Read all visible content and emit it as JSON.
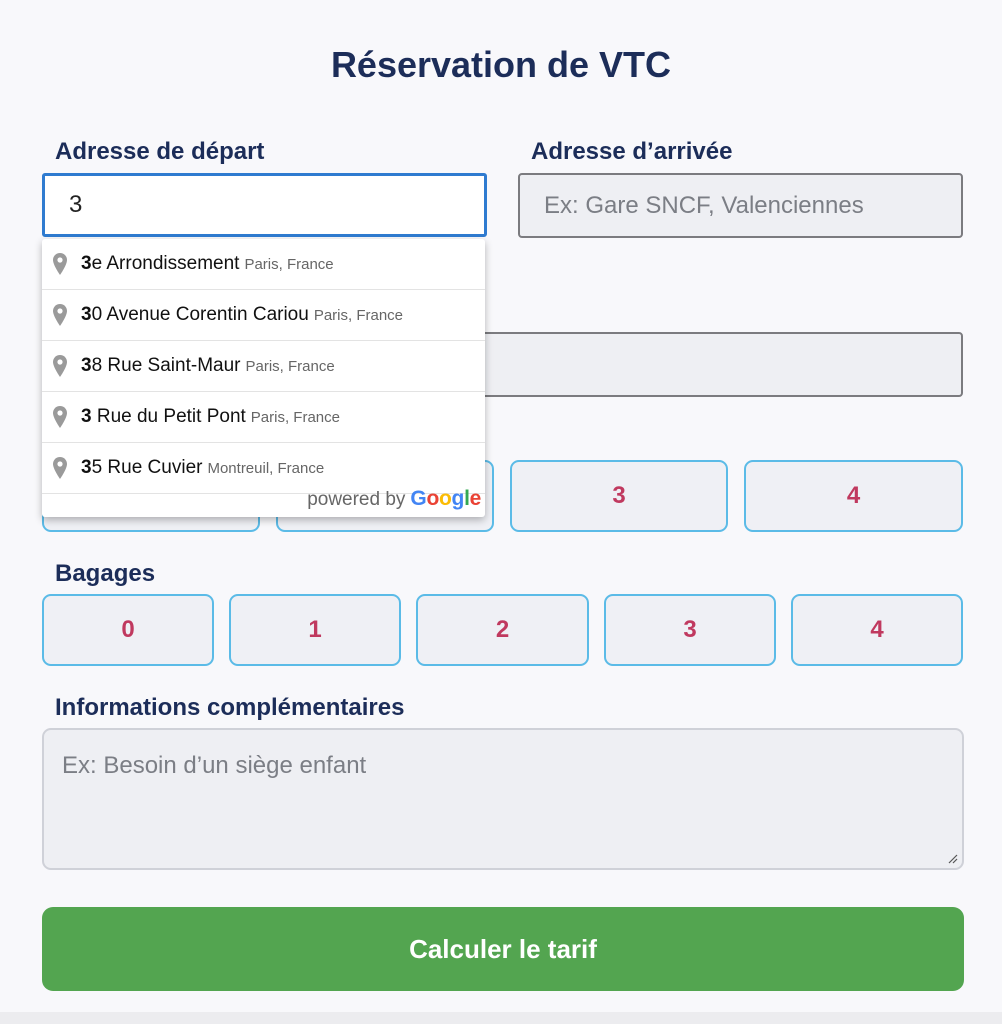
{
  "form": {
    "title": "Réservation de VTC",
    "departure": {
      "label": "Adresse de départ",
      "value": "3"
    },
    "arrival": {
      "label": "Adresse d’arrivée",
      "placeholder": "Ex: Gare SNCF, Valenciennes"
    },
    "passengers": {
      "visible_options": [
        "3",
        "4"
      ]
    },
    "luggage": {
      "label": "Bagages",
      "options": [
        "0",
        "1",
        "2",
        "3",
        "4"
      ]
    },
    "info": {
      "label": "Informations complémentaires",
      "placeholder": "Ex: Besoin d’un siège enfant"
    },
    "submit_label": "Calculer le tarif"
  },
  "autocomplete": {
    "suggestions": [
      {
        "match": "3",
        "rest": "e Arrondissement",
        "secondary": "Paris, France"
      },
      {
        "match": "3",
        "rest": "0 Avenue Corentin Cariou",
        "secondary": "Paris, France"
      },
      {
        "match": "3",
        "rest": "8 Rue Saint-Maur",
        "secondary": "Paris, France"
      },
      {
        "match": "3",
        "rest": " Rue du Petit Pont",
        "secondary": "Paris, France"
      },
      {
        "match": "3",
        "rest": "5 Rue Cuvier",
        "secondary": "Montreuil, France"
      }
    ],
    "powered_by": "powered by",
    "brand_letters": [
      "G",
      "o",
      "o",
      "g",
      "l",
      "e"
    ]
  },
  "colors": {
    "title": "#1c2d59",
    "option_text": "#c0395f",
    "option_border": "#5bbbe7",
    "submit_bg": "#53a550",
    "focus_border": "#2f7bd0",
    "google": [
      "#4285F4",
      "#EA4335",
      "#FBBC05",
      "#4285F4",
      "#34A853",
      "#EA4335"
    ]
  },
  "icons": {
    "suggestion": "map-pin-icon",
    "resize": "resize-grip-icon"
  }
}
